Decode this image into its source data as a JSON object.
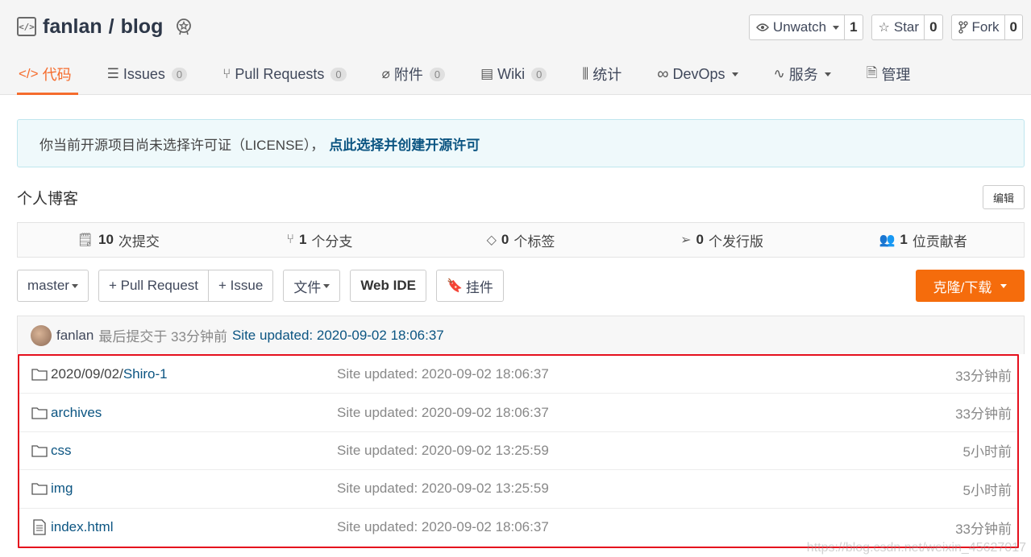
{
  "repo": {
    "owner": "fanlan",
    "separator": "/",
    "name": "blog"
  },
  "actions": [
    {
      "label": "Unwatch",
      "count": "1",
      "icon": "eye-icon",
      "has_caret": true
    },
    {
      "label": "Star",
      "count": "0",
      "icon": "star-icon",
      "has_caret": false
    },
    {
      "label": "Fork",
      "count": "0",
      "icon": "fork-icon",
      "has_caret": false
    }
  ],
  "tabs": [
    {
      "label": "代码",
      "icon": "code-icon",
      "active": true
    },
    {
      "label": "Issues",
      "badge": "0",
      "icon": "issues-icon"
    },
    {
      "label": "Pull Requests",
      "badge": "0",
      "icon": "pull-request-icon"
    },
    {
      "label": "附件",
      "badge": "0",
      "icon": "paperclip-icon"
    },
    {
      "label": "Wiki",
      "badge": "0",
      "icon": "book-icon"
    },
    {
      "label": "统计",
      "icon": "bar-chart-icon"
    },
    {
      "label": "DevOps",
      "icon": "infinity-icon",
      "has_caret": true
    },
    {
      "label": "服务",
      "icon": "pulse-icon",
      "has_caret": true
    },
    {
      "label": "管理",
      "icon": "document-icon"
    }
  ],
  "license": {
    "text": "你当前开源项目尚未选择许可证（LICENSE），",
    "link": "点此选择并创建开源许可"
  },
  "description": "个人博客",
  "edit_label": "编辑",
  "stats": [
    {
      "count": "10",
      "label": "次提交",
      "icon": "commit-icon"
    },
    {
      "count": "1",
      "label": "个分支",
      "icon": "branch-icon"
    },
    {
      "count": "0",
      "label": "个标签",
      "icon": "tag-icon"
    },
    {
      "count": "0",
      "label": "个发行版",
      "icon": "release-icon"
    },
    {
      "count": "1",
      "label": "位贡献者",
      "icon": "contributors-icon"
    }
  ],
  "toolbar": {
    "branch": "master",
    "pull_request": "+ Pull Request",
    "issue": "+ Issue",
    "file": "文件",
    "web_ide": "Web IDE",
    "widget": "挂件",
    "clone": "克隆/下载"
  },
  "commit": {
    "author": "fanlan",
    "meta": "最后提交于 33分钟前",
    "message": "Site updated: 2020-09-02 18:06:37"
  },
  "files": [
    {
      "prefix": "2020/09/02/",
      "name": "Shiro-1",
      "type": "folder",
      "message": "Site updated: 2020-09-02 18:06:37",
      "time": "33分钟前"
    },
    {
      "prefix": "",
      "name": "archives",
      "type": "folder",
      "message": "Site updated: 2020-09-02 18:06:37",
      "time": "33分钟前"
    },
    {
      "prefix": "",
      "name": "css",
      "type": "folder",
      "message": "Site updated: 2020-09-02 13:25:59",
      "time": "5小时前"
    },
    {
      "prefix": "",
      "name": "img",
      "type": "folder",
      "message": "Site updated: 2020-09-02 13:25:59",
      "time": "5小时前"
    },
    {
      "prefix": "",
      "name": "index.html",
      "type": "file",
      "message": "Site updated: 2020-09-02 18:06:37",
      "time": "33分钟前"
    }
  ],
  "watermark": "https://blog.csdn.net/weixin_45627017",
  "colors": {
    "accent": "#f56c2d",
    "clone_button": "#f56c0c",
    "link": "#0c5582",
    "highlight_border": "#e5101d"
  }
}
